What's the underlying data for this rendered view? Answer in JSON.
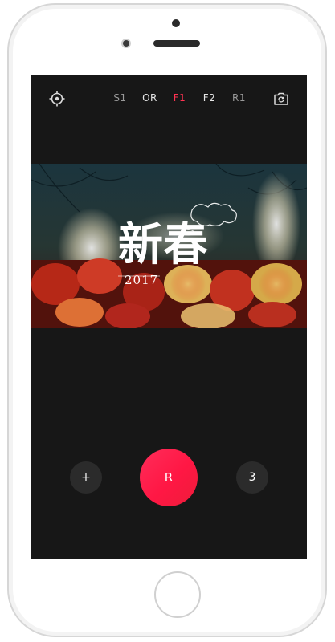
{
  "topbar": {
    "modes": [
      "S1",
      "OR",
      "F1",
      "F2",
      "R1"
    ],
    "active_mode": "F1"
  },
  "photo": {
    "title_glyphs": "新春",
    "year": "2017"
  },
  "controls": {
    "add_label": "+",
    "shutter_label": "R",
    "count_label": "3"
  },
  "colors": {
    "accent": "#ff2d55",
    "screen_bg": "#171717",
    "control_bg": "#2b2b2b"
  }
}
